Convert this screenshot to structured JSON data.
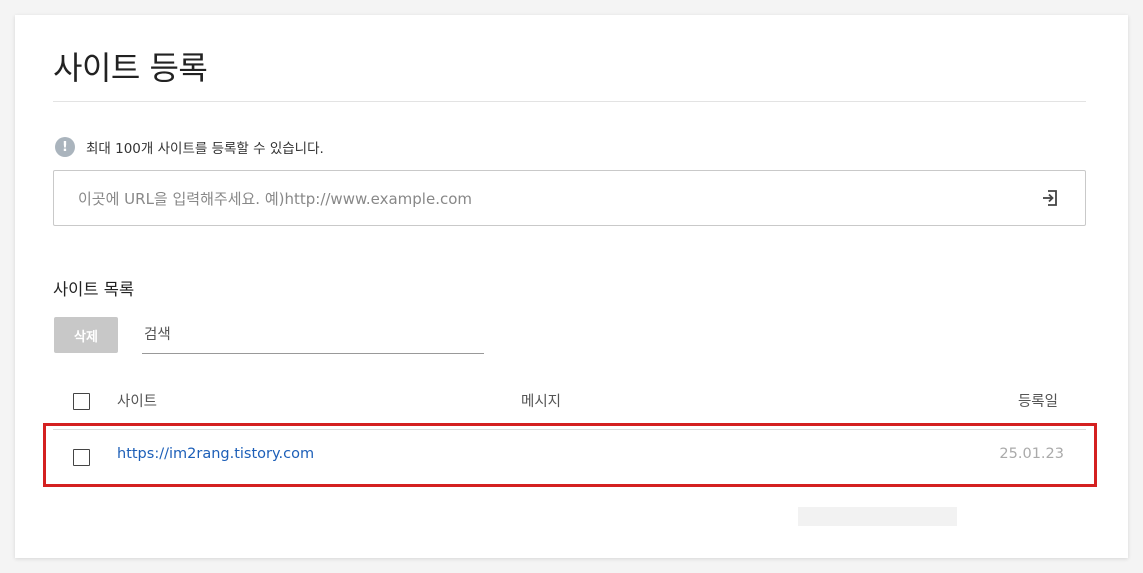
{
  "page": {
    "title": "사이트 등록",
    "notice_icon": "!",
    "notice_text": "최대 100개 사이트를 등록할 수 있습니다."
  },
  "url_input": {
    "value": "",
    "placeholder": "이곳에 URL을 입력해주세요. 예)http://www.example.com",
    "submit_icon": "enter-arrow-icon"
  },
  "site_list": {
    "title": "사이트 목록",
    "delete_label": "삭제",
    "search_value": "",
    "search_placeholder": "검색",
    "columns": {
      "site": "사이트",
      "message": "메시지",
      "registered": "등록일"
    },
    "rows": [
      {
        "site": "https://im2rang.tistory.com",
        "message": "",
        "registered": "25.01.23",
        "checked": false
      }
    ]
  },
  "colors": {
    "link": "#1d5fb8",
    "highlight": "#d42020",
    "disabled_button": "#c8c8c8"
  }
}
